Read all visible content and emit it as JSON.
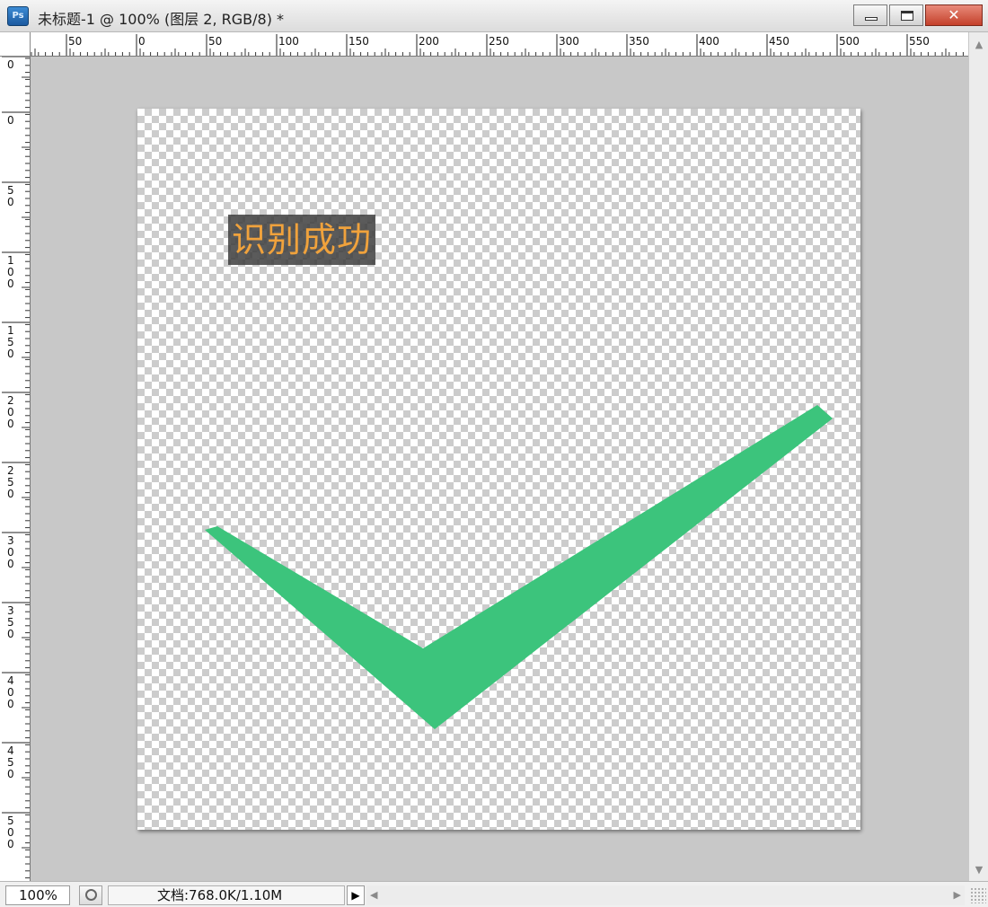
{
  "window": {
    "app_icon_label": "Ps",
    "title": "未标题-1 @ 100% (图层 2, RGB/8) *"
  },
  "ruler_top": {
    "labels": [
      "50",
      "0",
      "50",
      "100",
      "150",
      "200",
      "250",
      "300",
      "350",
      "400",
      "450",
      "500",
      "550"
    ]
  },
  "ruler_left": {
    "labels": [
      "0",
      "0",
      "50",
      "100",
      "150",
      "200",
      "250",
      "300",
      "350",
      "400",
      "450",
      "500"
    ]
  },
  "canvas": {
    "label_text": "识别成功",
    "label_text_color": "#f0a23c",
    "checkmark_color": "#3cc47c",
    "checker_colors": [
      "#ffffff",
      "#cccccc"
    ]
  },
  "status_bar": {
    "zoom": "100%",
    "doc_info": "文档:768.0K/1.10M"
  },
  "icons": {
    "minimize": "minimize-icon",
    "maximize": "maximize-icon",
    "close": "close-icon",
    "status_menu": "triangle-right-icon",
    "proof": "proof-icon"
  }
}
